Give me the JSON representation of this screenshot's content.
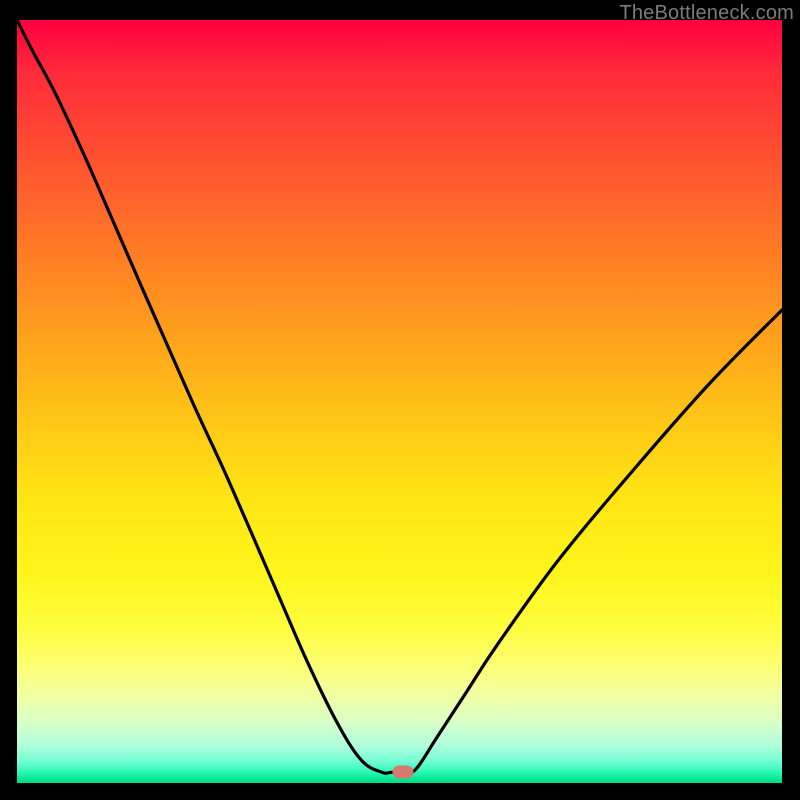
{
  "watermark": "TheBottleneck.com",
  "colors": {
    "gradient_top": "#ff0040",
    "gradient_mid": "#ffe614",
    "gradient_bottom": "#00d986",
    "curve": "#000000",
    "marker": "#d7796e",
    "frame": "#000000"
  },
  "marker": {
    "x_frac": 0.505,
    "y_frac": 0.986
  },
  "chart_data": {
    "type": "line",
    "title": "",
    "xlabel": "",
    "ylabel": "",
    "xlim": [
      0,
      100
    ],
    "ylim": [
      0,
      100
    ],
    "series": [
      {
        "name": "bottleneck-curve",
        "x": [
          0,
          2.0,
          5.2,
          9.8,
          16.3,
          22.9,
          27.5,
          34.0,
          37.9,
          41.8,
          45.0,
          47.7,
          49.0,
          51.0,
          52.3,
          54.9,
          58.8,
          62.7,
          70.6,
          79.7,
          90.2,
          100.0
        ],
        "y": [
          100.0,
          96.0,
          90.0,
          80.0,
          65.0,
          50.0,
          40.0,
          25.0,
          16.0,
          8.0,
          3.0,
          1.4,
          1.4,
          1.4,
          2.0,
          6.0,
          12.0,
          18.0,
          29.0,
          40.0,
          52.0,
          62.0
        ]
      }
    ],
    "annotations": [
      {
        "type": "point",
        "name": "optimal-marker",
        "x": 50.5,
        "y": 1.4
      }
    ],
    "grid": false,
    "legend": false
  }
}
